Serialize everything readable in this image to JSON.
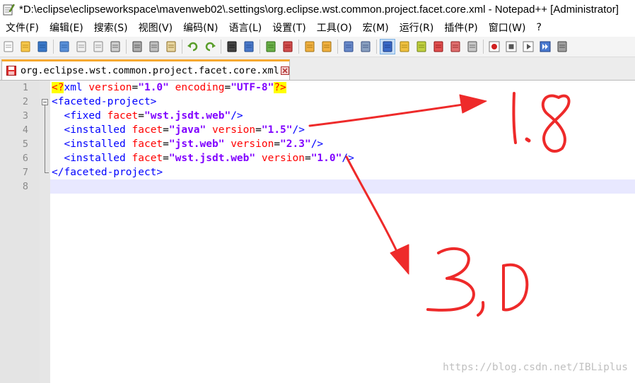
{
  "window": {
    "title": "*D:\\eclipse\\eclipseworkspace\\mavenweb02\\.settings\\org.eclipse.wst.common.project.facet.core.xml - Notepad++ [Administrator]"
  },
  "menu": [
    "文件(F)",
    "编辑(E)",
    "搜索(S)",
    "视图(V)",
    "编码(N)",
    "语言(L)",
    "设置(T)",
    "工具(O)",
    "宏(M)",
    "运行(R)",
    "插件(P)",
    "窗口(W)",
    "?"
  ],
  "toolbar_icons": [
    "new-file-icon",
    "open-file-icon",
    "save-icon",
    "save-all-icon",
    "close-icon",
    "close-all-icon",
    "print-icon",
    "cut-icon",
    "copy-icon",
    "paste-icon",
    "undo-icon",
    "redo-icon",
    "find-icon",
    "replace-icon",
    "zoom-in-icon",
    "zoom-out-icon",
    "sync-vertical-icon",
    "sync-horizontal-icon",
    "word-wrap-icon",
    "show-all-chars-icon",
    "indent-guide-icon",
    "udl-icon",
    "doc-map-icon",
    "function-list-icon",
    "folder-workspace-icon",
    "monitor-icon",
    "record-macro-icon",
    "stop-record-icon",
    "play-macro-icon",
    "run-macro-multiple-icon",
    "save-macro-icon"
  ],
  "tab": {
    "label": "org.eclipse.wst.common.project.facet.core.xml"
  },
  "editor": {
    "line_numbers": [
      "1",
      "2",
      "3",
      "4",
      "5",
      "6",
      "7",
      "8"
    ],
    "lines": [
      {
        "tokens": [
          {
            "c": "pi",
            "t": "<?"
          },
          {
            "c": "t",
            "t": "xml "
          },
          {
            "c": "a",
            "t": "version"
          },
          {
            "c": "punc",
            "t": "="
          },
          {
            "c": "v",
            "t": "\"1.0\""
          },
          {
            "c": "punc",
            "t": " "
          },
          {
            "c": "a",
            "t": "encoding"
          },
          {
            "c": "punc",
            "t": "="
          },
          {
            "c": "v",
            "t": "\"UTF-8\""
          },
          {
            "c": "pi",
            "t": "?>"
          }
        ]
      },
      {
        "tokens": [
          {
            "c": "t",
            "t": "<faceted-project>"
          }
        ]
      },
      {
        "tokens": [
          {
            "c": "punc",
            "t": "  "
          },
          {
            "c": "t",
            "t": "<fixed "
          },
          {
            "c": "a",
            "t": "facet"
          },
          {
            "c": "punc",
            "t": "="
          },
          {
            "c": "v",
            "t": "\"wst.jsdt.web\""
          },
          {
            "c": "t",
            "t": "/>"
          }
        ]
      },
      {
        "tokens": [
          {
            "c": "punc",
            "t": "  "
          },
          {
            "c": "t",
            "t": "<installed "
          },
          {
            "c": "a",
            "t": "facet"
          },
          {
            "c": "punc",
            "t": "="
          },
          {
            "c": "v",
            "t": "\"java\""
          },
          {
            "c": "punc",
            "t": " "
          },
          {
            "c": "a",
            "t": "version"
          },
          {
            "c": "punc",
            "t": "="
          },
          {
            "c": "v",
            "t": "\"1.5\""
          },
          {
            "c": "t",
            "t": "/>"
          }
        ]
      },
      {
        "tokens": [
          {
            "c": "punc",
            "t": "  "
          },
          {
            "c": "t",
            "t": "<installed "
          },
          {
            "c": "a",
            "t": "facet"
          },
          {
            "c": "punc",
            "t": "="
          },
          {
            "c": "v",
            "t": "\"jst.web\""
          },
          {
            "c": "punc",
            "t": " "
          },
          {
            "c": "a",
            "t": "version"
          },
          {
            "c": "punc",
            "t": "="
          },
          {
            "c": "v",
            "t": "\"2.3\""
          },
          {
            "c": "t",
            "t": "/>"
          }
        ]
      },
      {
        "tokens": [
          {
            "c": "punc",
            "t": "  "
          },
          {
            "c": "t",
            "t": "<installed "
          },
          {
            "c": "a",
            "t": "facet"
          },
          {
            "c": "punc",
            "t": "="
          },
          {
            "c": "v",
            "t": "\"wst.jsdt.web\""
          },
          {
            "c": "punc",
            "t": " "
          },
          {
            "c": "a",
            "t": "version"
          },
          {
            "c": "punc",
            "t": "="
          },
          {
            "c": "v",
            "t": "\"1.0\""
          },
          {
            "c": "t",
            "t": "/>"
          }
        ]
      },
      {
        "tokens": [
          {
            "c": "t",
            "t": "</faceted-project>"
          }
        ]
      },
      {
        "tokens": []
      }
    ]
  },
  "annotations": {
    "java_target": "1.8",
    "web_target": "3.0",
    "color": "#ee2a2a"
  },
  "watermark": "https://blog.csdn.net/IBLiplus"
}
